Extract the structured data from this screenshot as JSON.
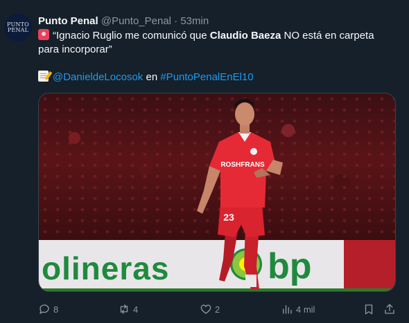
{
  "tweet": {
    "author_name": "Punto Penal",
    "author_handle": "@Punto_Penal",
    "separator": "·",
    "time": "53min",
    "avatar_line1": "PUNTO",
    "avatar_line2": "PENAL",
    "text_line1_pre": "“Ignacio Ruglio me comunicó que ",
    "text_line1_bold": "Claudio Baeza",
    "text_line1_post": " NO está en carpeta",
    "text_line2": "para incorporar”",
    "credit_mention": "@DanieldeLocosok",
    "credit_word": " en ",
    "credit_hashtag": "#PuntoPenalEnEl10"
  },
  "media": {
    "banner_text": "olineras",
    "banner_brand": "bp",
    "jersey_sponsor": "ROSHFRANS",
    "jersey_number": "23"
  },
  "actions": {
    "replies": "8",
    "retweets": "4",
    "likes": "2",
    "views": "4 mil"
  },
  "colors": {
    "background": "#15202b",
    "link": "#1d9bf0",
    "muted": "#8b98a5",
    "jersey_red": "#e52a35"
  },
  "icons": [
    "siren-emoji-icon",
    "memo-emoji-icon",
    "reply-icon",
    "retweet-icon",
    "like-icon",
    "views-icon",
    "bookmark-icon",
    "share-icon"
  ]
}
